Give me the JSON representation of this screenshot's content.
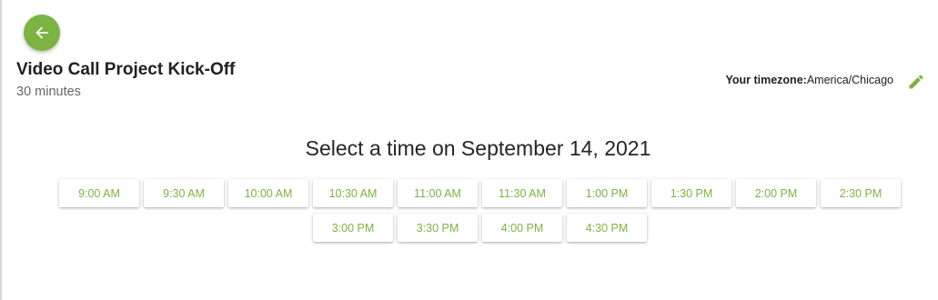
{
  "event": {
    "title": "Video Call Project Kick-Off",
    "duration": "30 minutes"
  },
  "timezone": {
    "label": "Your timezone:",
    "value": "America/Chicago"
  },
  "heading": "Select a time on September 14, 2021",
  "time_slots": [
    "9:00 AM",
    "9:30 AM",
    "10:00 AM",
    "10:30 AM",
    "11:00 AM",
    "11:30 AM",
    "1:00 PM",
    "1:30 PM",
    "2:00 PM",
    "2:30 PM",
    "3:00 PM",
    "3:30 PM",
    "4:00 PM",
    "4:30 PM"
  ],
  "icons": {
    "back": "arrow-left-icon",
    "edit": "pencil-icon"
  },
  "colors": {
    "accent": "#7cb342",
    "title": "#212121",
    "muted": "#666666"
  }
}
